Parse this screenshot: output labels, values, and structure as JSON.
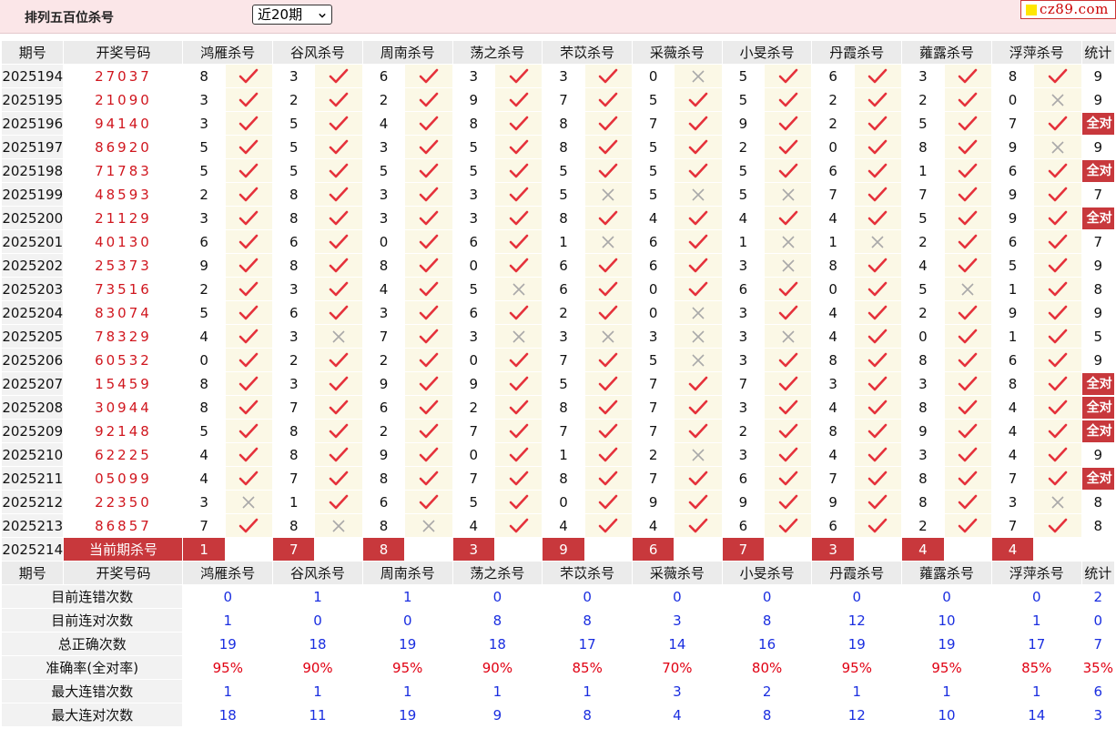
{
  "header": {
    "title": "排列五百位杀号",
    "select_value": "近20期",
    "logo_text": "cz89.com"
  },
  "columns": {
    "period": "期号",
    "draw": "开奖号码",
    "experts": [
      "鸿雁杀号",
      "谷风杀号",
      "周南杀号",
      "荡之杀号",
      "芣苡杀号",
      "采薇杀号",
      "小旻杀号",
      "丹霞杀号",
      "蕹露杀号",
      "浮萍杀号"
    ],
    "stats": "统计"
  },
  "rows": [
    {
      "period": "2025194",
      "draw": "27037",
      "kills": [
        8,
        3,
        6,
        3,
        3,
        0,
        5,
        6,
        3,
        8
      ],
      "hits": [
        1,
        1,
        1,
        1,
        1,
        0,
        1,
        1,
        1,
        1
      ],
      "stat": "9"
    },
    {
      "period": "2025195",
      "draw": "21090",
      "kills": [
        3,
        2,
        2,
        9,
        7,
        5,
        5,
        2,
        2,
        0
      ],
      "hits": [
        1,
        1,
        1,
        1,
        1,
        1,
        1,
        1,
        1,
        0
      ],
      "stat": "9"
    },
    {
      "period": "2025196",
      "draw": "94140",
      "kills": [
        3,
        5,
        4,
        8,
        8,
        7,
        9,
        2,
        5,
        7
      ],
      "hits": [
        1,
        1,
        1,
        1,
        1,
        1,
        1,
        1,
        1,
        1
      ],
      "stat": "全对"
    },
    {
      "period": "2025197",
      "draw": "86920",
      "kills": [
        5,
        5,
        3,
        5,
        8,
        5,
        2,
        0,
        8,
        9
      ],
      "hits": [
        1,
        1,
        1,
        1,
        1,
        1,
        1,
        1,
        1,
        0
      ],
      "stat": "9"
    },
    {
      "period": "2025198",
      "draw": "71783",
      "kills": [
        5,
        5,
        5,
        5,
        5,
        5,
        5,
        6,
        1,
        6
      ],
      "hits": [
        1,
        1,
        1,
        1,
        1,
        1,
        1,
        1,
        1,
        1
      ],
      "stat": "全对"
    },
    {
      "period": "2025199",
      "draw": "48593",
      "kills": [
        2,
        8,
        3,
        3,
        5,
        5,
        5,
        7,
        7,
        9
      ],
      "hits": [
        1,
        1,
        1,
        1,
        0,
        0,
        0,
        1,
        1,
        1
      ],
      "stat": "7"
    },
    {
      "period": "2025200",
      "draw": "21129",
      "kills": [
        3,
        8,
        3,
        3,
        8,
        4,
        4,
        4,
        5,
        9
      ],
      "hits": [
        1,
        1,
        1,
        1,
        1,
        1,
        1,
        1,
        1,
        1
      ],
      "stat": "全对"
    },
    {
      "period": "2025201",
      "draw": "40130",
      "kills": [
        6,
        6,
        0,
        6,
        1,
        6,
        1,
        1,
        2,
        6
      ],
      "hits": [
        1,
        1,
        1,
        1,
        0,
        1,
        0,
        0,
        1,
        1
      ],
      "stat": "7"
    },
    {
      "period": "2025202",
      "draw": "25373",
      "kills": [
        9,
        8,
        8,
        0,
        6,
        6,
        3,
        8,
        4,
        5
      ],
      "hits": [
        1,
        1,
        1,
        1,
        1,
        1,
        0,
        1,
        1,
        1
      ],
      "stat": "9"
    },
    {
      "period": "2025203",
      "draw": "73516",
      "kills": [
        2,
        3,
        4,
        5,
        6,
        0,
        6,
        0,
        5,
        1
      ],
      "hits": [
        1,
        1,
        1,
        0,
        1,
        1,
        1,
        1,
        0,
        1
      ],
      "stat": "8"
    },
    {
      "period": "2025204",
      "draw": "83074",
      "kills": [
        5,
        6,
        3,
        6,
        2,
        0,
        3,
        4,
        2,
        9
      ],
      "hits": [
        1,
        1,
        1,
        1,
        1,
        0,
        1,
        1,
        1,
        1
      ],
      "stat": "9"
    },
    {
      "period": "2025205",
      "draw": "78329",
      "kills": [
        4,
        3,
        7,
        3,
        3,
        3,
        3,
        4,
        0,
        1
      ],
      "hits": [
        1,
        0,
        1,
        0,
        0,
        0,
        0,
        1,
        1,
        1
      ],
      "stat": "5"
    },
    {
      "period": "2025206",
      "draw": "60532",
      "kills": [
        0,
        2,
        2,
        0,
        7,
        5,
        3,
        8,
        8,
        6
      ],
      "hits": [
        1,
        1,
        1,
        1,
        1,
        0,
        1,
        1,
        1,
        1
      ],
      "stat": "9"
    },
    {
      "period": "2025207",
      "draw": "15459",
      "kills": [
        8,
        3,
        9,
        9,
        5,
        7,
        7,
        3,
        3,
        8
      ],
      "hits": [
        1,
        1,
        1,
        1,
        1,
        1,
        1,
        1,
        1,
        1
      ],
      "stat": "全对"
    },
    {
      "period": "2025208",
      "draw": "30944",
      "kills": [
        8,
        7,
        6,
        2,
        8,
        7,
        3,
        4,
        8,
        4
      ],
      "hits": [
        1,
        1,
        1,
        1,
        1,
        1,
        1,
        1,
        1,
        1
      ],
      "stat": "全对"
    },
    {
      "period": "2025209",
      "draw": "92148",
      "kills": [
        5,
        8,
        2,
        7,
        7,
        7,
        2,
        8,
        9,
        4
      ],
      "hits": [
        1,
        1,
        1,
        1,
        1,
        1,
        1,
        1,
        1,
        1
      ],
      "stat": "全对"
    },
    {
      "period": "2025210",
      "draw": "62225",
      "kills": [
        4,
        8,
        9,
        0,
        1,
        2,
        3,
        4,
        3,
        4
      ],
      "hits": [
        1,
        1,
        1,
        1,
        1,
        0,
        1,
        1,
        1,
        1
      ],
      "stat": "9"
    },
    {
      "period": "2025211",
      "draw": "05099",
      "kills": [
        4,
        7,
        8,
        7,
        8,
        7,
        6,
        7,
        8,
        7
      ],
      "hits": [
        1,
        1,
        1,
        1,
        1,
        1,
        1,
        1,
        1,
        1
      ],
      "stat": "全对"
    },
    {
      "period": "2025212",
      "draw": "22350",
      "kills": [
        3,
        1,
        6,
        5,
        0,
        9,
        9,
        9,
        8,
        3
      ],
      "hits": [
        0,
        1,
        1,
        1,
        1,
        1,
        1,
        1,
        1,
        0
      ],
      "stat": "8"
    },
    {
      "period": "2025213",
      "draw": "86857",
      "kills": [
        7,
        8,
        8,
        4,
        4,
        4,
        6,
        6,
        2,
        7
      ],
      "hits": [
        1,
        0,
        0,
        1,
        1,
        1,
        1,
        1,
        1,
        1
      ],
      "stat": "8"
    }
  ],
  "current": {
    "period": "2025214",
    "label": "当前期杀号",
    "kills": [
      "1",
      "7",
      "8",
      "3",
      "9",
      "6",
      "7",
      "3",
      "4",
      "4"
    ]
  },
  "summary": [
    {
      "label": "目前连错次数",
      "values": [
        "0",
        "1",
        "1",
        "0",
        "0",
        "0",
        "0",
        "0",
        "0",
        "0"
      ],
      "stat": "2"
    },
    {
      "label": "目前连对次数",
      "values": [
        "1",
        "0",
        "0",
        "8",
        "8",
        "3",
        "8",
        "12",
        "10",
        "1"
      ],
      "stat": "0"
    },
    {
      "label": "总正确次数",
      "values": [
        "19",
        "18",
        "19",
        "18",
        "17",
        "14",
        "16",
        "19",
        "19",
        "17"
      ],
      "stat": "7"
    },
    {
      "label": "准确率(全对率)",
      "values": [
        "95%",
        "90%",
        "95%",
        "90%",
        "85%",
        "70%",
        "80%",
        "95%",
        "95%",
        "85%"
      ],
      "stat": "35%",
      "highlight": true
    },
    {
      "label": "最大连错次数",
      "values": [
        "1",
        "1",
        "1",
        "1",
        "1",
        "3",
        "2",
        "1",
        "1",
        "1"
      ],
      "stat": "6"
    },
    {
      "label": "最大连对次数",
      "values": [
        "18",
        "11",
        "19",
        "9",
        "8",
        "4",
        "8",
        "12",
        "10",
        "14"
      ],
      "stat": "3"
    }
  ],
  "colors": {
    "check": "#e5313b",
    "cross": "#a9a9a9",
    "accent": "#c8383c",
    "blue": "#1a2ee0"
  }
}
